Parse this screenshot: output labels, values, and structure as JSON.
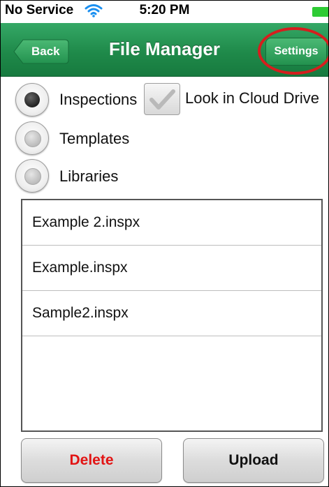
{
  "status_bar": {
    "carrier": "No Service",
    "time": "5:20 PM",
    "wifi_icon": "wifi-icon",
    "battery_icon": "battery-icon",
    "battery_color": "#2ecb34"
  },
  "nav_bar": {
    "back_label": "Back",
    "title": "File Manager",
    "settings_label": "Settings",
    "bar_color": "#1f8a4a",
    "highlight_color": "#d61e1e"
  },
  "filters": {
    "inspections": {
      "label": "Inspections",
      "selected": true
    },
    "templates": {
      "label": "Templates",
      "selected": false
    },
    "libraries": {
      "label": "Libraries",
      "selected": false
    },
    "cloud": {
      "label": "Look in Cloud Drive",
      "checked": true
    }
  },
  "files": [
    "Example 2.inspx",
    "Example.inspx",
    "Sample2.inspx"
  ],
  "actions": {
    "delete_label": "Delete",
    "upload_label": "Upload",
    "delete_color": "#e21414"
  }
}
